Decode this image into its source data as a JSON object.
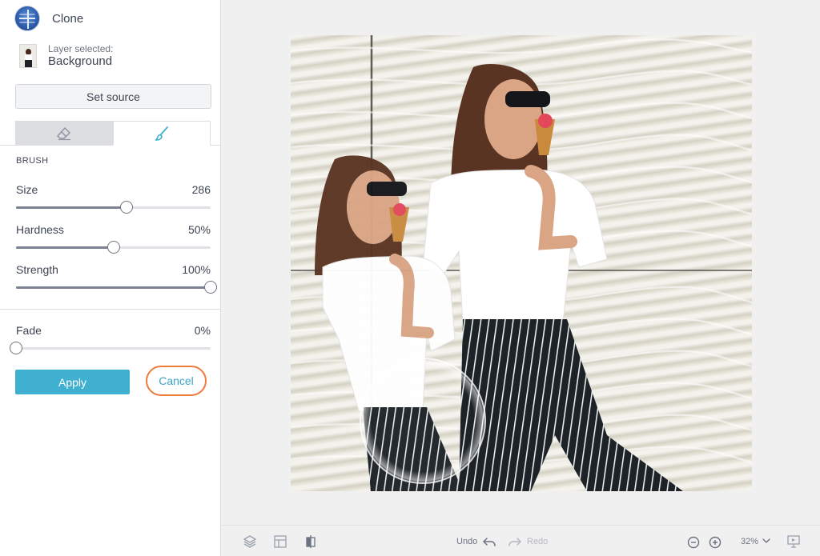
{
  "tool": {
    "title": "Clone",
    "icon": "clone-tool-icon"
  },
  "layer": {
    "caption": "Layer selected:",
    "name": "Background"
  },
  "set_source_label": "Set source",
  "tabs": [
    {
      "name": "eraser",
      "icon": "eraser-icon",
      "active": false
    },
    {
      "name": "brush",
      "icon": "brush-icon",
      "active": true
    }
  ],
  "brush": {
    "section_label": "BRUSH",
    "sliders": [
      {
        "label": "Size",
        "value_text": "286",
        "fraction": 0.567
      },
      {
        "label": "Hardness",
        "value_text": "50%",
        "fraction": 0.5
      },
      {
        "label": "Strength",
        "value_text": "100%",
        "fraction": 1.0
      }
    ]
  },
  "fade": {
    "label": "Fade",
    "value_text": "0%",
    "fraction": 0.0
  },
  "actions": {
    "apply_label": "Apply",
    "cancel_label": "Cancel"
  },
  "colors": {
    "accent": "#3fb0d0",
    "highlight": "#ee7a3c",
    "slider_fill": "#7b8190"
  },
  "bottombar": {
    "undo_label": "Undo",
    "redo_label": "Redo",
    "zoom_level": "32%",
    "icons": [
      "layers-icon",
      "grid-icon",
      "compare-icon",
      "undo-icon",
      "redo-icon",
      "zoom-out-icon",
      "zoom-in-icon",
      "chevron-down-icon",
      "presentation-icon"
    ]
  }
}
